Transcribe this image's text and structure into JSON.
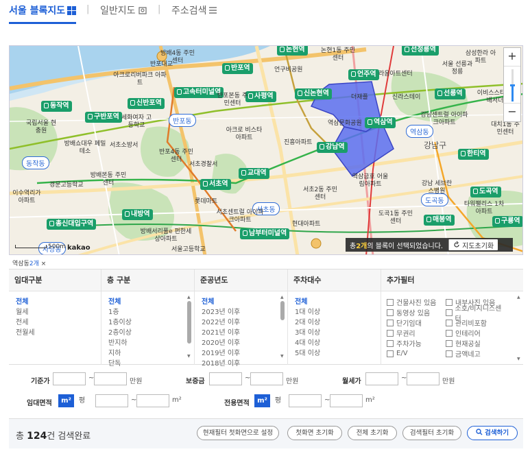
{
  "tabs": [
    {
      "label": "서울 블록지도",
      "icon": "grid-icon",
      "active": true
    },
    {
      "label": "일반지도",
      "icon": "map-pin-icon",
      "active": false
    },
    {
      "label": "주소검색",
      "icon": "list-icon",
      "active": false
    }
  ],
  "map": {
    "stations": [
      "논현역",
      "선정릉역",
      "반포역",
      "고속터미널역",
      "언주역",
      "사평역",
      "신논현역",
      "선릉역",
      "동작역",
      "신반포역",
      "구반포역",
      "역삼역",
      "강남역",
      "한티역",
      "교대역",
      "서초역",
      "도곡역",
      "내방역",
      "매봉역",
      "구룡역",
      "총신대입구역",
      "남부터미널역"
    ],
    "dong_labels": [
      "반포동",
      "동작동",
      "역삼동",
      "서초동",
      "도곡동",
      "사당동"
    ],
    "places": [
      "반포대교",
      "아크로리버파크 아파트",
      "세화여자 고등학교",
      "국립서울 현충원",
      "방배쇼대우 폐밀테소",
      "서초소방서",
      "반포4동 주민센터",
      "방배본동 주민센터",
      "경문고등학교",
      "이수역리가 아파트",
      "서초경찰서",
      "롯데마트",
      "서초센트럴 아이파크아파트",
      "방배서리풀e 편한세상아파트",
      "서울고등학교",
      "서초2동 주민센터",
      "현대아파트",
      "역삼금호 어울림아파트",
      "도곡1동 주민센터",
      "강남 세브란스병원",
      "타워팰리스 1차아파트",
      "대치1동 주민센터",
      "삼성한라 아파트",
      "서울 선릉과정릉",
      "이비스스타 앰배서더",
      "강남센트럴 아이파크아파트",
      "진흥아파트",
      "아크로 비스타아파트",
      "라움아트센터",
      "신라스테이",
      "더재플",
      "역삼문화공원",
      "논현1동 주민센터",
      "언구비공원",
      "반포본동 주민센터",
      "방배4동 주민센터"
    ],
    "gu": [
      "강남구"
    ],
    "status_prefix": "총 ",
    "status_count": "2개",
    "status_suffix": "의 블록이 선택되었습니다.",
    "reset_label": "지도초기화",
    "scale": "500m",
    "provider": "kakao",
    "zoom_in": "+",
    "zoom_out": "−",
    "zoom_level": 0.55
  },
  "selected_chip": {
    "name": "역삼동",
    "count": "2개",
    "close": "×"
  },
  "filters": [
    {
      "header": "임대구분",
      "options": [
        "전체",
        "월세",
        "전세",
        "전월세"
      ],
      "selected": "전체"
    },
    {
      "header": "층 구분",
      "options": [
        "전체",
        "1층",
        "1층이상",
        "2층이상",
        "반지하",
        "지하",
        "단독"
      ],
      "selected": "전체"
    },
    {
      "header": "준공년도",
      "options": [
        "전체",
        "2023년 이후",
        "2022년 이후",
        "2021년 이후",
        "2020년 이후",
        "2019년 이후",
        "2018년 이후"
      ],
      "selected": "전체"
    },
    {
      "header": "주차대수",
      "options": [
        "전체",
        "1대 이상",
        "2대 이상",
        "3대 이상",
        "4대 이상",
        "5대 이상"
      ],
      "selected": "전체"
    },
    {
      "header": "추가필터",
      "checkboxes": [
        "건물사진 있음",
        "내부사진 있음",
        "동영상 있음",
        "소호/비지니스센터",
        "단기임대",
        "관리비포함",
        "무권리",
        "인테리어",
        "주차가능",
        "현재공실",
        "E/V",
        "금액네고"
      ]
    }
  ],
  "ranges": {
    "deposit_label": "기준가",
    "deposit_unit": "만원",
    "security_label": "보증금",
    "security_unit": "만원",
    "monthly_label": "월세가",
    "monthly_unit": "만원",
    "lease_area_label": "임대면적",
    "use_area_label": "전용면적",
    "unit_m2": "m²",
    "unit_pyeong": "평",
    "tilde": "~"
  },
  "bottom": {
    "total_prefix": "총 ",
    "total_count": "124",
    "total_suffix": "건 검색완료",
    "buttons": [
      "현재필터 첫화면으로 설정",
      "첫화면 초기화",
      "전체 초기화",
      "검색필터 초기화"
    ],
    "search_label": "검색하기"
  }
}
